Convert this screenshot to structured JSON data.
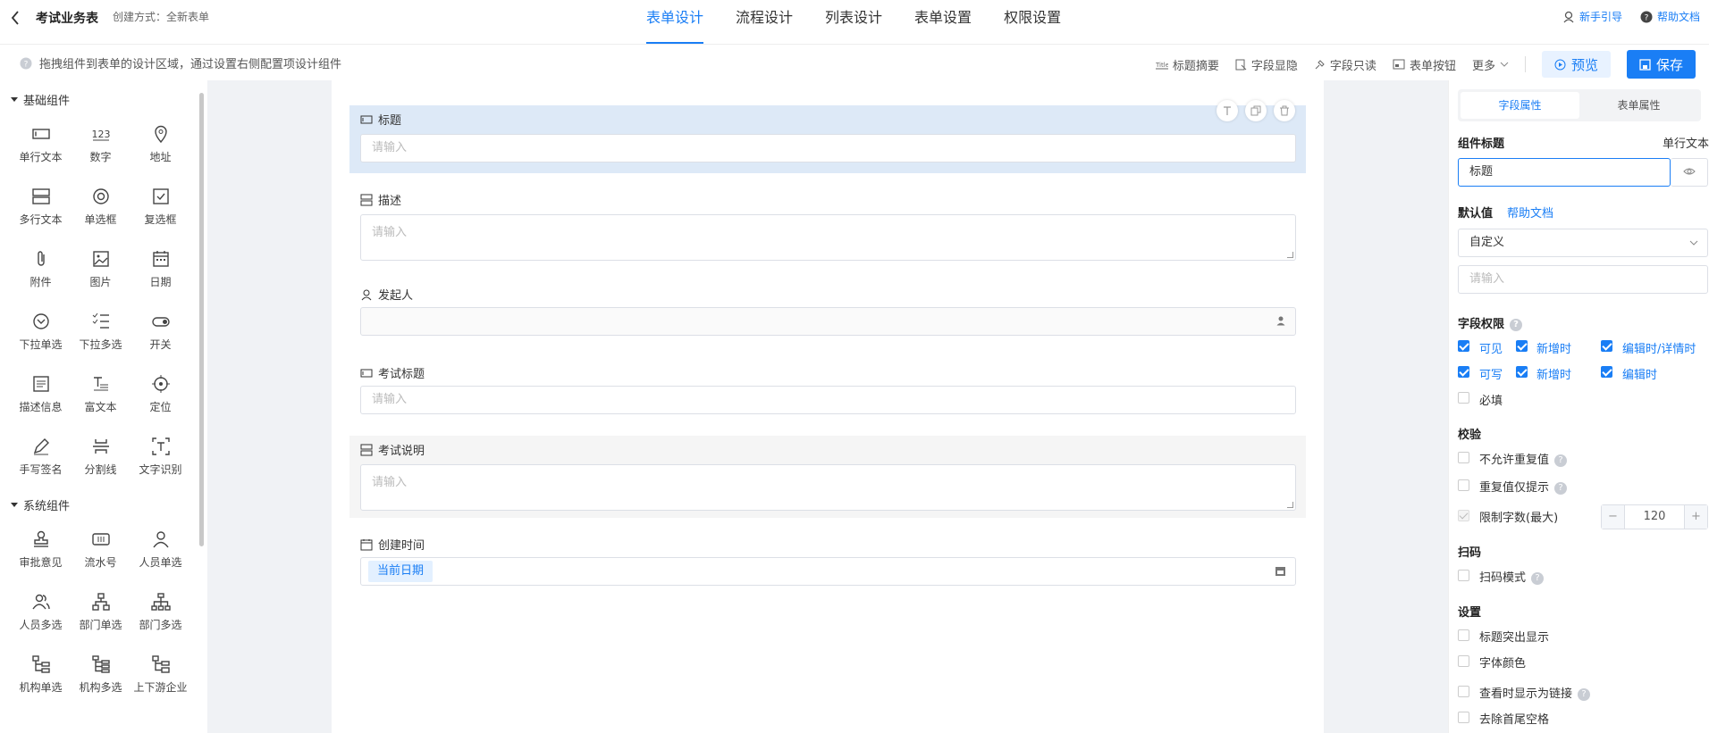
{
  "header": {
    "form_title": "考试业务表",
    "creation_method": "创建方式：全新表单",
    "tabs": [
      {
        "label": "表单设计",
        "active": true
      },
      {
        "label": "流程设计"
      },
      {
        "label": "列表设计"
      },
      {
        "label": "表单设置"
      },
      {
        "label": "权限设置"
      }
    ],
    "links": {
      "guide": "新手引导",
      "help": "帮助文档"
    }
  },
  "toolbar": {
    "hint": "拖拽组件到表单的设计区域，通过设置右侧配置项设计组件",
    "actions": {
      "title_summary": "标题摘要",
      "field_visibility": "字段显隐",
      "field_readonly": "字段只读",
      "form_buttons": "表单按钮",
      "more": "更多"
    },
    "preview": "预览",
    "save": "保存"
  },
  "left": {
    "basic_title": "基础组件",
    "basic": [
      {
        "label": "单行文本",
        "icon": "single-line-text-icon"
      },
      {
        "label": "数字",
        "icon": "number-icon"
      },
      {
        "label": "地址",
        "icon": "location-pin-icon"
      },
      {
        "label": "多行文本",
        "icon": "multi-line-text-icon"
      },
      {
        "label": "单选框",
        "icon": "radio-icon"
      },
      {
        "label": "复选框",
        "icon": "checkbox-icon"
      },
      {
        "label": "附件",
        "icon": "paperclip-icon"
      },
      {
        "label": "图片",
        "icon": "image-icon"
      },
      {
        "label": "日期",
        "icon": "calendar-icon"
      },
      {
        "label": "下拉单选",
        "icon": "dropdown-single-icon"
      },
      {
        "label": "下拉多选",
        "icon": "dropdown-multi-icon"
      },
      {
        "label": "开关",
        "icon": "switch-icon"
      },
      {
        "label": "描述信息",
        "icon": "description-icon"
      },
      {
        "label": "富文本",
        "icon": "rich-text-icon"
      },
      {
        "label": "定位",
        "icon": "crosshair-icon"
      },
      {
        "label": "手写签名",
        "icon": "pen-icon"
      },
      {
        "label": "分割线",
        "icon": "divider-icon"
      },
      {
        "label": "文字识别",
        "icon": "ocr-icon"
      }
    ],
    "system_title": "系统组件",
    "system": [
      {
        "label": "审批意见",
        "icon": "stamp-icon"
      },
      {
        "label": "流水号",
        "icon": "serial-number-icon"
      },
      {
        "label": "人员单选",
        "icon": "person-icon"
      },
      {
        "label": "人员多选",
        "icon": "people-icon"
      },
      {
        "label": "部门单选",
        "icon": "org-tree-icon"
      },
      {
        "label": "部门多选",
        "icon": "org-tree-multi-icon"
      },
      {
        "label": "机构单选",
        "icon": "institution-icon"
      },
      {
        "label": "机构多选",
        "icon": "institution-multi-icon"
      },
      {
        "label": "上下游企业",
        "icon": "enterprise-icon"
      }
    ]
  },
  "canvas": {
    "fields": [
      {
        "label": "标题",
        "placeholder": "请输入"
      },
      {
        "label": "描述",
        "placeholder": "请输入"
      },
      {
        "label": "发起人",
        "placeholder": ""
      },
      {
        "label": "考试标题",
        "placeholder": "请输入"
      },
      {
        "label": "考试说明",
        "placeholder": "请输入"
      },
      {
        "label": "创建时间",
        "tag": "当前日期"
      }
    ]
  },
  "right": {
    "tabs": {
      "field_props": "字段属性",
      "form_props": "表单属性"
    },
    "component_title_label": "组件标题",
    "component_type": "单行文本",
    "component_title_value": "标题",
    "default_label": "默认值",
    "help_link": "帮助文档",
    "default_mode": "自定义",
    "default_placeholder": "请输入",
    "perm_label": "字段权限",
    "perm": {
      "visible": "可见",
      "visible_new": "新增时",
      "visible_edit": "编辑时/详情时",
      "writable": "可写",
      "writable_new": "新增时",
      "writable_edit": "编辑时",
      "required": "必填"
    },
    "validation_label": "校验",
    "no_duplicate": "不允许重复值",
    "duplicate_hint": "重复值仅提示",
    "limit_chars": "限制字数(最大)",
    "limit_value": "120",
    "scan_label": "扫码",
    "scan_mode": "扫码模式",
    "settings_label": "设置",
    "highlight_title": "标题突出显示",
    "font_color": "字体颜色",
    "show_as_link": "查看时显示为链接",
    "trim_spaces": "去除首尾空格"
  }
}
